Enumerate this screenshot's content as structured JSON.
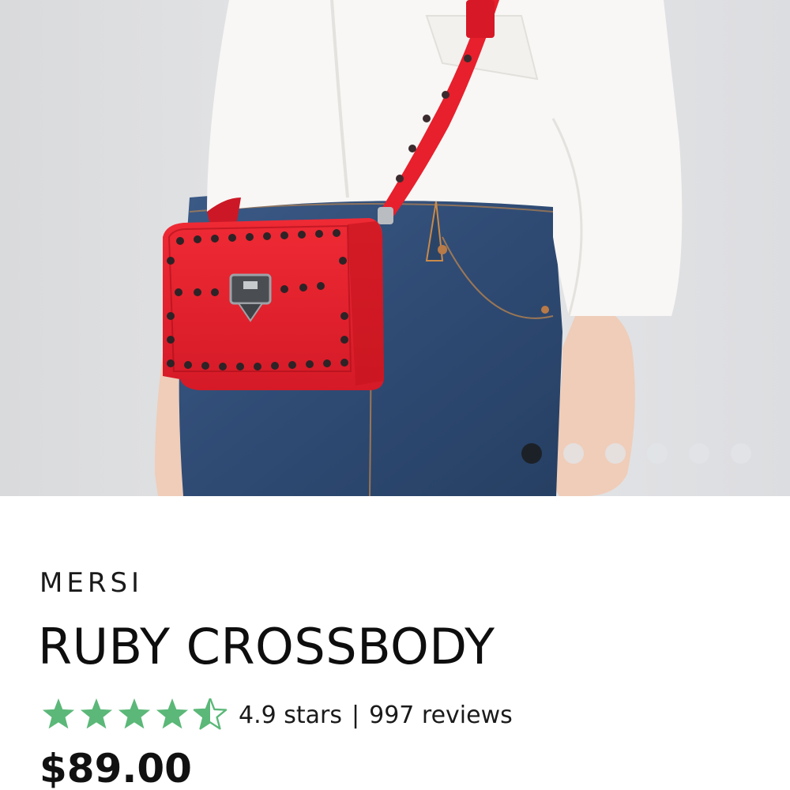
{
  "product": {
    "brand": "MERSI",
    "name": "RUBY CROSSBODY",
    "price": "$89.00",
    "rating": {
      "value": 4.5,
      "max": 5,
      "stars_text": "4.9 stars",
      "separator": "|",
      "reviews_text": "997 reviews"
    }
  },
  "gallery": {
    "image_count": 6,
    "active_index": 0
  },
  "colors": {
    "star_green": "#5bb878",
    "bag_red": "#e8202e",
    "active_dot": "#1c2128",
    "inactive_dot": "#e1e4e8",
    "background": "#e3e4e6"
  },
  "icons": {
    "star": "star-icon",
    "half_star": "half-star-icon"
  }
}
